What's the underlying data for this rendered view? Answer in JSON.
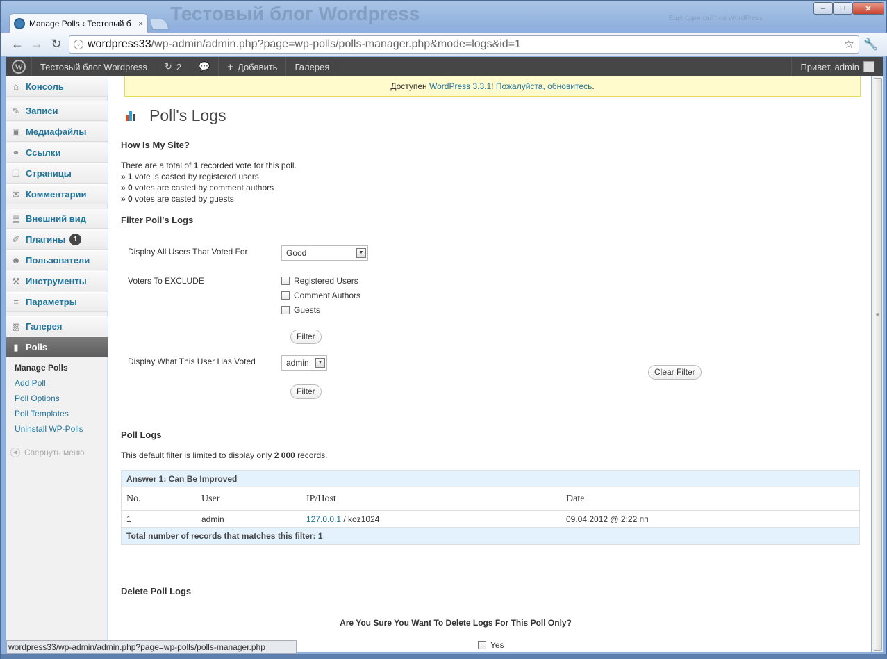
{
  "browser": {
    "tab_title": "Manage Polls ‹ Тестовый б",
    "tab_close": "×",
    "window_title": "Тестовый блог Wordpress",
    "window_subtitle": "Ещё один сайт на WordPress",
    "min": "–",
    "max": "□",
    "close": "✕",
    "back": "←",
    "forward": "→",
    "reload": "↻",
    "url_host": "wordpress33",
    "url_path": "/wp-admin/admin.php?page=wp-polls/polls-manager.php&mode=logs&id=1",
    "star": "☆",
    "wrench": "🔧"
  },
  "adminbar": {
    "logo": "W",
    "site": "Тестовый блог Wordpress",
    "updates_icon": "↻",
    "updates": "2",
    "comments_icon": "💬",
    "add_icon": "+",
    "add": "Добавить",
    "gallery": "Галерея",
    "greeting": "Привет, admin"
  },
  "sidebar": {
    "items": [
      {
        "label": "Консоль",
        "icon": "⌂"
      },
      {
        "label": "Записи",
        "icon": "✎"
      },
      {
        "label": "Медиафайлы",
        "icon": "▣"
      },
      {
        "label": "Ссылки",
        "icon": "⚭"
      },
      {
        "label": "Страницы",
        "icon": "❐"
      },
      {
        "label": "Комментарии",
        "icon": "✉"
      },
      {
        "label": "Внешний вид",
        "icon": "▤"
      },
      {
        "label": "Плагины",
        "icon": "✐",
        "badge": "1"
      },
      {
        "label": "Пользователи",
        "icon": "☻"
      },
      {
        "label": "Инструменты",
        "icon": "⚒"
      },
      {
        "label": "Параметры",
        "icon": "≡"
      },
      {
        "label": "Галерея",
        "icon": "▧"
      },
      {
        "label": "Polls",
        "icon": "▮"
      }
    ],
    "sub": [
      "Manage Polls",
      "Add Poll",
      "Poll Options",
      "Poll Templates",
      "Uninstall WP-Polls"
    ],
    "collapse_icon": "◀",
    "collapse": "Свернуть меню"
  },
  "notice": {
    "pre": "Доступен ",
    "link1": "WordPress 3.3.1",
    "mid": "! ",
    "link2": "Пожалуйста, обновитесь",
    "post": "."
  },
  "page": {
    "title": "Poll's Logs",
    "poll_name": "How Is My Site?",
    "total_pre": "There are a total of ",
    "total_n": "1",
    "total_post": " recorded vote for this poll.",
    "arrow": "»",
    "reg_n": "1",
    "reg_t": " vote is casted by registered users",
    "com_n": "0",
    "com_t": " votes are casted by comment authors",
    "gue_n": "0",
    "gue_t": " votes are casted by guests",
    "filter_heading": "Filter Poll's Logs",
    "display_all": "Display All Users That Voted For",
    "answer_select": "Good",
    "exclude": "Voters To EXCLUDE",
    "cb1": "Registered Users",
    "cb2": "Comment Authors",
    "cb3": "Guests",
    "filter_btn": "Filter",
    "display_user": "Display What This User Has Voted",
    "user_select": "admin",
    "clear_btn": "Clear Filter",
    "logs_heading": "Poll Logs",
    "limit_pre": "This default filter is limited to display only ",
    "limit_n": "2 000",
    "limit_post": " records.",
    "delete_heading": "Delete Poll Logs",
    "delete_q": "Are You Sure You Want To Delete Logs For This Poll Only?",
    "yes": "Yes"
  },
  "table": {
    "answer": "Answer 1: Can Be Improved",
    "headers": [
      "No.",
      "User",
      "IP/Host",
      "Date"
    ],
    "rows": [
      {
        "no": "1",
        "user": "admin",
        "ip": "127.0.0.1",
        "host": " / koz1024",
        "date": "09.04.2012 @ 2:22 пп"
      }
    ],
    "total": "Total number of records that matches this filter: 1"
  },
  "status": "wordpress33/wp-admin/admin.php?page=wp-polls/polls-manager.php",
  "colors": {
    "accent": "#21759b",
    "adminbar": "#464646",
    "notice": "#fffbcc"
  }
}
